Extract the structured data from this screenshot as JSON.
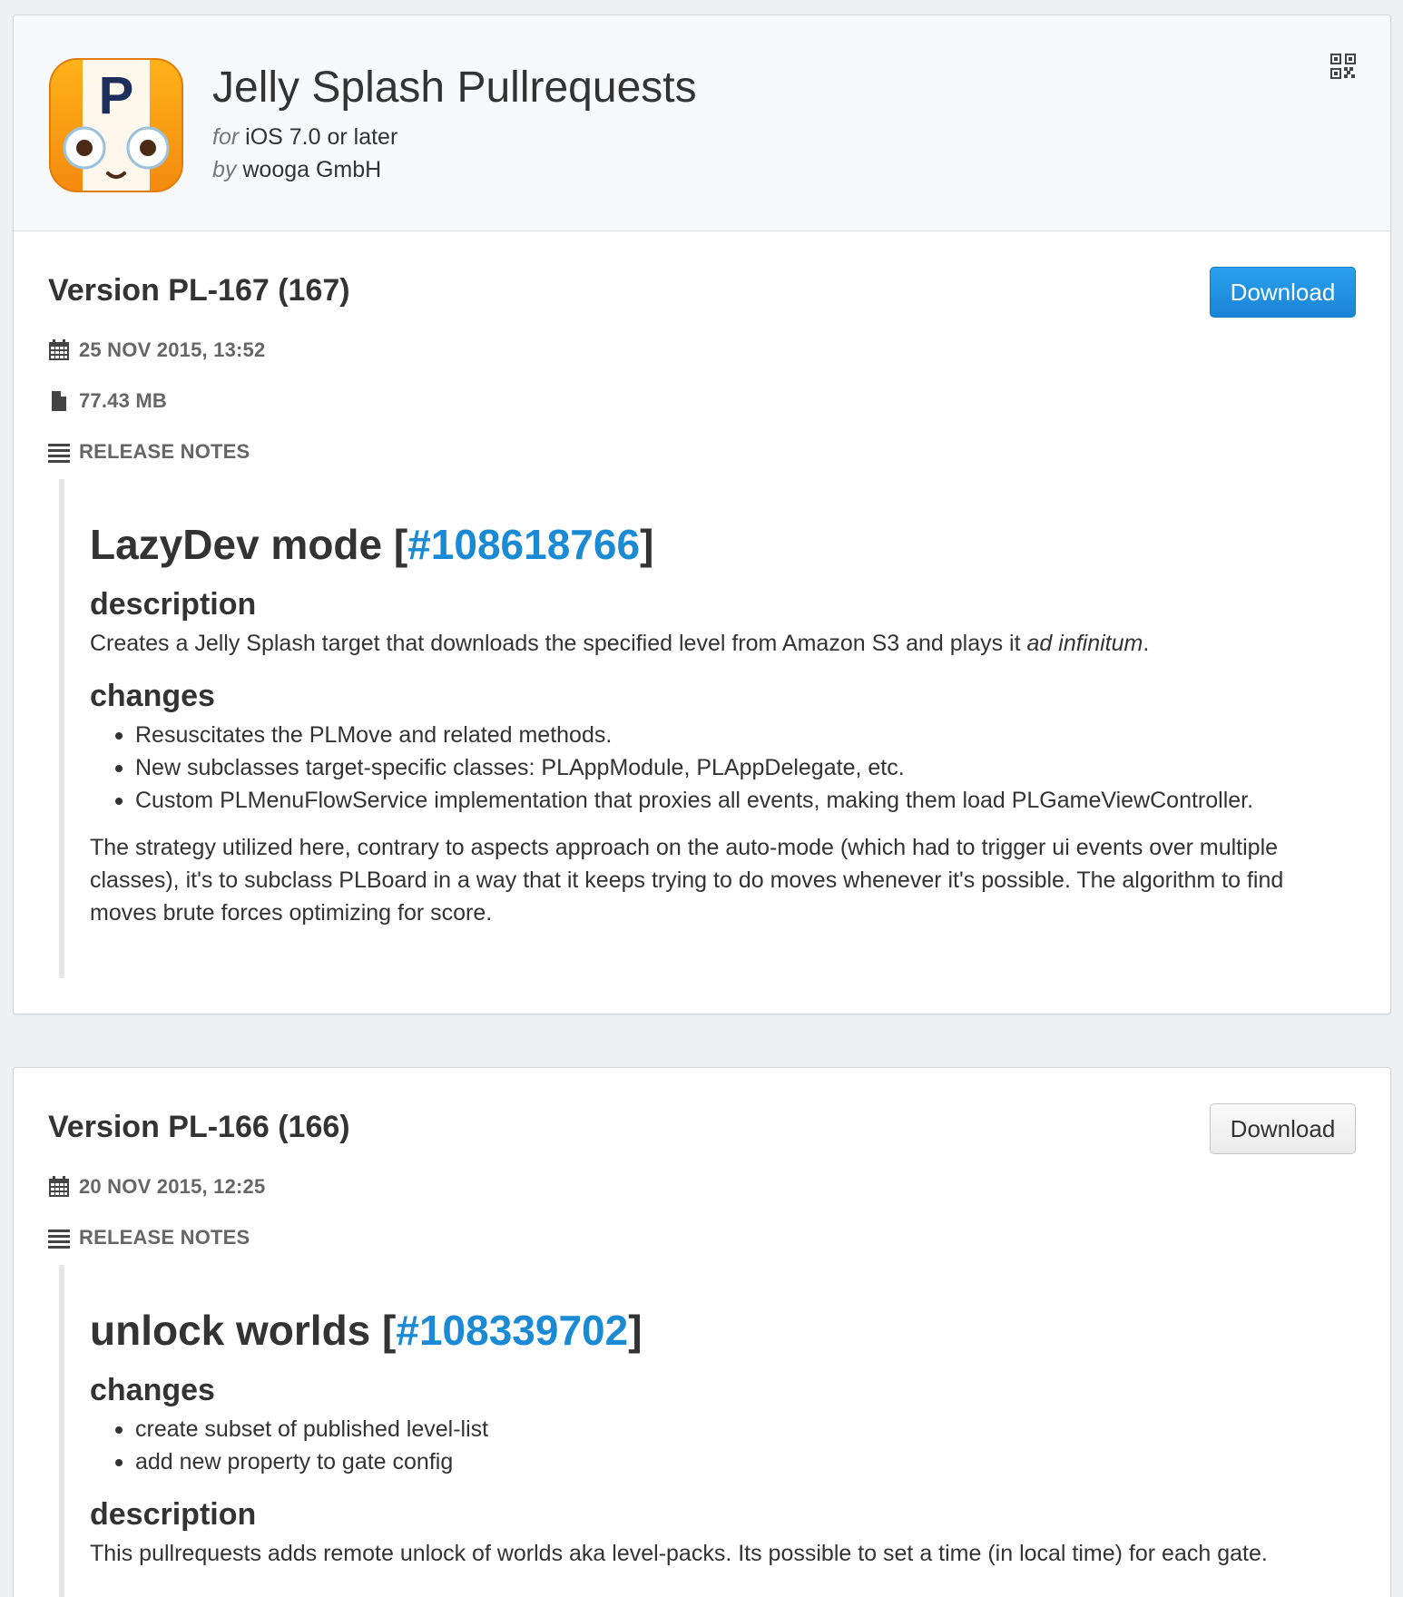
{
  "app": {
    "title": "Jelly Splash Pullrequests",
    "os_prefix": "for",
    "os": "iOS 7.0 or later",
    "developer_prefix": "by",
    "developer": "wooga GmbH",
    "icon_letter": "P",
    "icon_name": "app-icon",
    "qr_icon": "qr-code-icon"
  },
  "colors": {
    "accent": "#1a8ad4",
    "primary_button": "#1a84d6",
    "background": "#eef1f3"
  },
  "versions": [
    {
      "title": "Version PL-167 (167)",
      "download_label": "Download",
      "date": "25 NOV 2015, 13:52",
      "size": "77.43 MB",
      "notes_label": "RELEASE NOTES",
      "notes": {
        "heading_text": "LazyDev mode [",
        "heading_link": "#108618766",
        "heading_close": "]",
        "desc_title": "description",
        "desc_text_start": "Creates a Jelly Splash target that downloads the specified level from Amazon S3 and plays it ",
        "desc_text_italic": "ad infinitum",
        "desc_text_end": ".",
        "changes_title": "changes",
        "changes": [
          "Resuscitates the PLMove and related methods.",
          "New subclasses target-specific classes: PLAppModule, PLAppDelegate, etc.",
          "Custom PLMenuFlowService implementation that proxies all events, making them load PLGameViewController."
        ],
        "strategy": "The strategy utilized here, contrary to aspects approach on the auto-mode (which had to trigger ui events over multiple classes), it's to subclass PLBoard in a way that it keeps trying to do moves whenever it's possible. The algorithm to find moves brute forces optimizing for score."
      }
    },
    {
      "title": "Version PL-166 (166)",
      "download_label": "Download",
      "date": "20 NOV 2015, 12:25",
      "notes_label": "RELEASE NOTES",
      "notes": {
        "heading_text": "unlock worlds [",
        "heading_link": "#108339702",
        "heading_close": "]",
        "changes_title": "changes",
        "changes": [
          "create subset of published level-list",
          "add new property to gate config"
        ],
        "desc_title": "description",
        "desc_text": "This pullrequests adds remote unlock of worlds aka level-packs. Its possible to set a time (in local time) for each gate."
      }
    }
  ]
}
